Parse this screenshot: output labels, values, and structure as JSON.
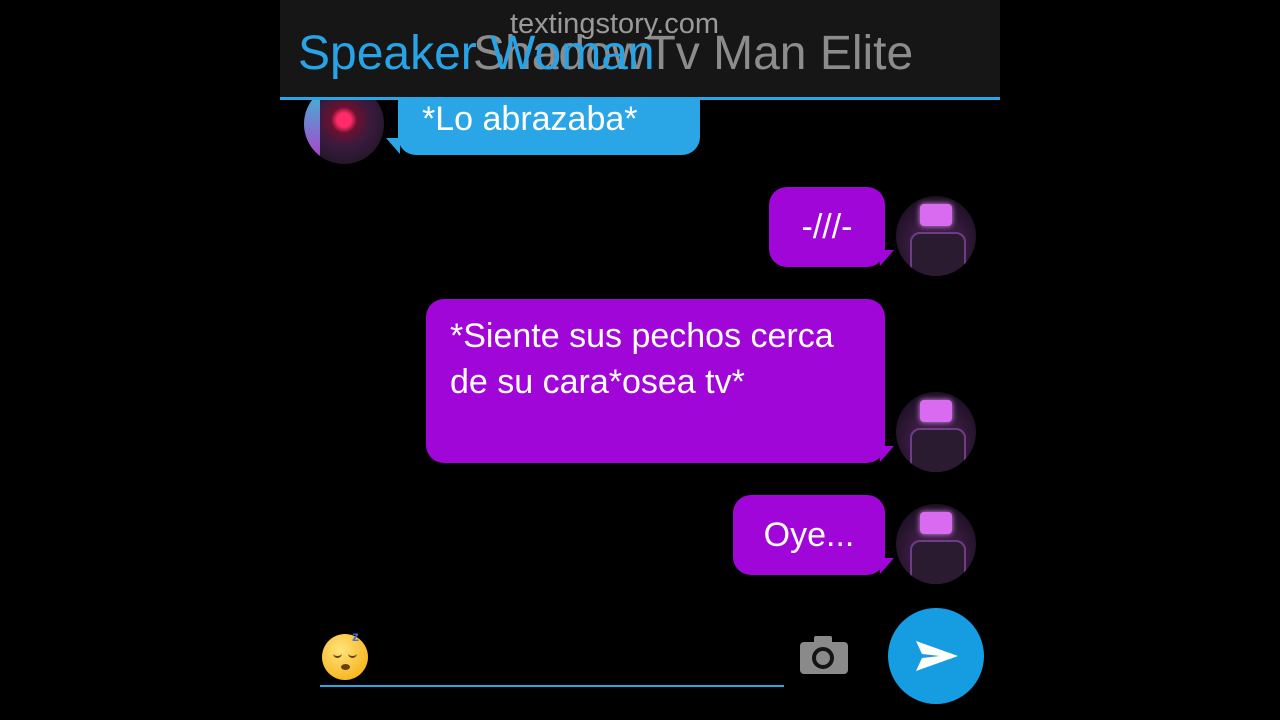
{
  "header": {
    "watermark": "textingstory.com",
    "contact_name_a": "Speaker Woman",
    "contact_name_b": "ShadowTv Man Elite"
  },
  "messages": [
    {
      "side": "left",
      "text": "*Lo abrazaba*"
    },
    {
      "side": "right",
      "text": "-///-"
    },
    {
      "side": "right",
      "text": "*Siente sus pechos cerca de su cara*osea tv*"
    },
    {
      "side": "right",
      "text": "Oye..."
    }
  ],
  "composer": {
    "emoji_icon": "sleeping-face-icon",
    "camera_icon": "camera-icon",
    "send_icon": "send-icon"
  },
  "colors": {
    "header_bg": "#161616",
    "accent_blue": "#2aa6e6",
    "sent_bubble": "#a106d8",
    "send_button": "#169ce0"
  }
}
